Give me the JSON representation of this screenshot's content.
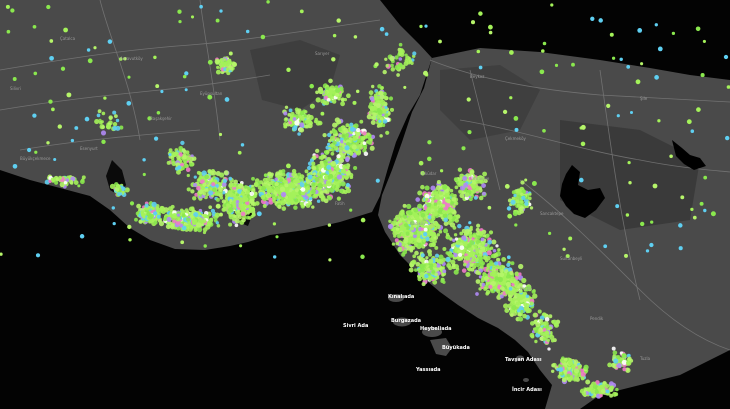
{
  "map": {
    "colors": {
      "sea": "#030303",
      "land": "#4a4a4a",
      "land_dark": "#3b3b3b",
      "road": "#7c7c7c",
      "lake": "#000000",
      "island_label": "#ffffff",
      "district_label": "#9a9a9a"
    },
    "point_palette": [
      "#a4f25a",
      "#b6f56a",
      "#8ae84e",
      "#5fd0f2",
      "#b08af5",
      "#f07ac8",
      "#ffffff"
    ],
    "island_labels": [
      "Kınalıada",
      "Burgazada",
      "Sivri Ada",
      "Heybeliada",
      "Büyükada",
      "Yassıada",
      "Tavşan Adası",
      "İncir Adası"
    ],
    "district_labels": [
      "Arnavutköy",
      "Eyüpsultan",
      "Sarıyer",
      "Beykoz",
      "Çekmeköy",
      "Şile",
      "Başakşehir",
      "Esenyurt",
      "Büyükçekmece",
      "Silivri",
      "Çatalca",
      "Sultanbeyli",
      "Pendik",
      "Tuzla",
      "Kartal",
      "Ümraniye",
      "Sancaktepe",
      "Kadıköy",
      "Üsküdar",
      "Fatih"
    ]
  }
}
